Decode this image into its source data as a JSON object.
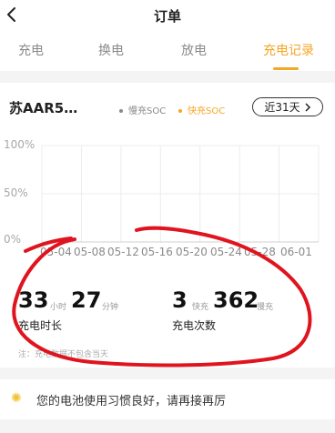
{
  "header": {
    "title": "订单"
  },
  "tabs": [
    {
      "label": "充电",
      "active": false
    },
    {
      "label": "换电",
      "active": false
    },
    {
      "label": "放电",
      "active": false
    },
    {
      "label": "充电记录",
      "active": true
    }
  ],
  "vehicle": {
    "plate": "苏AAR5…"
  },
  "legend": [
    {
      "label": "慢充SOC",
      "color": "#888888"
    },
    {
      "label": "快充SOC",
      "color": "#f5a623"
    }
  ],
  "range_selector": {
    "label": "近31天",
    "icon": "chevron-right-icon"
  },
  "chart_data": {
    "type": "line",
    "yticks": [
      "100%",
      "50%",
      "0%"
    ],
    "ylim": [
      0,
      100
    ],
    "x": [
      "05-04",
      "05-08",
      "05-12",
      "05-16",
      "05-20",
      "05-24",
      "05-28",
      "06-01"
    ],
    "series": [],
    "grid": true
  },
  "stats": {
    "duration": {
      "hours": "33",
      "hours_unit": "小时",
      "minutes": "27",
      "minutes_unit": "分钟",
      "label": "充电时长"
    },
    "count": {
      "fast": "3",
      "fast_unit": "快充",
      "slow": "362",
      "slow_unit": "慢充",
      "label": "充电次数"
    }
  },
  "note": "注：充电数据不包含当天",
  "tip": {
    "icon": "sun-icon",
    "text": "您的电池使用习惯良好，请再接再厉"
  },
  "annotation_color": "#e0141e"
}
